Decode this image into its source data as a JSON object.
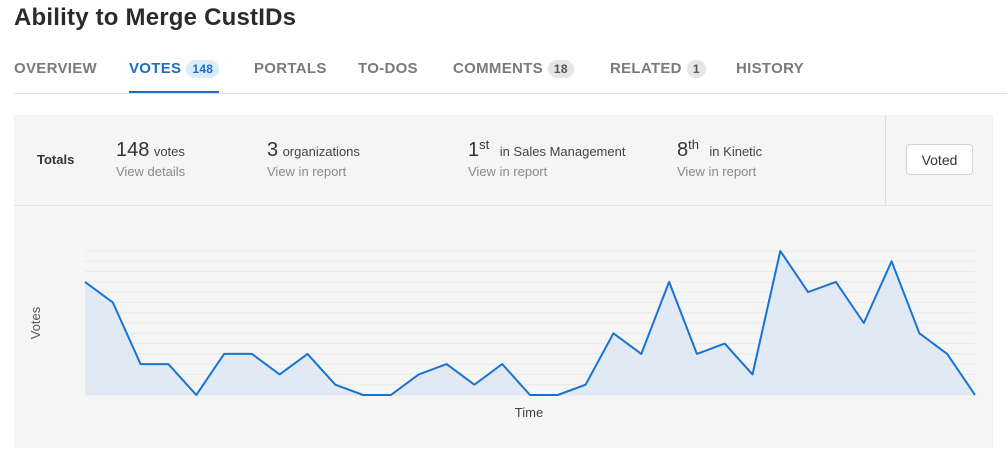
{
  "page": {
    "title": "Ability to Merge CustIDs"
  },
  "tabs": [
    {
      "label": "OVERVIEW",
      "badge": null,
      "active": false
    },
    {
      "label": "VOTES",
      "badge": "148",
      "active": true
    },
    {
      "label": "PORTALS",
      "badge": null,
      "active": false
    },
    {
      "label": "TO-DOS",
      "badge": null,
      "active": false
    },
    {
      "label": "COMMENTS",
      "badge": "18",
      "active": false
    },
    {
      "label": "RELATED",
      "badge": "1",
      "active": false
    },
    {
      "label": "HISTORY",
      "badge": null,
      "active": false
    }
  ],
  "totals": {
    "label": "Totals",
    "votes": {
      "value": "148",
      "unit": "votes",
      "link": "View details"
    },
    "organizations": {
      "value": "3",
      "unit": "organizations",
      "link": "View in report"
    },
    "rank_sales": {
      "value": "1",
      "suffix": "st",
      "unit": "in Sales Management",
      "link": "View in report"
    },
    "rank_kinetic": {
      "value": "8",
      "suffix": "th",
      "unit": "in Kinetic",
      "link": "View in report"
    },
    "voted_label": "Voted"
  },
  "colors": {
    "accent": "#1b6ec2",
    "line": "#1874d0",
    "area": "#dde8f3"
  },
  "chart_data": {
    "type": "area",
    "xlabel": "Time",
    "ylabel": "Votes",
    "grid": true,
    "series": [
      {
        "values": [
          11,
          9,
          3,
          3,
          0,
          4,
          4,
          2,
          4,
          1,
          0,
          0,
          2,
          3,
          1,
          3,
          0,
          0,
          1,
          6,
          4,
          11,
          4,
          5,
          2,
          14,
          10,
          11,
          7,
          13,
          6,
          4,
          0
        ]
      }
    ]
  }
}
